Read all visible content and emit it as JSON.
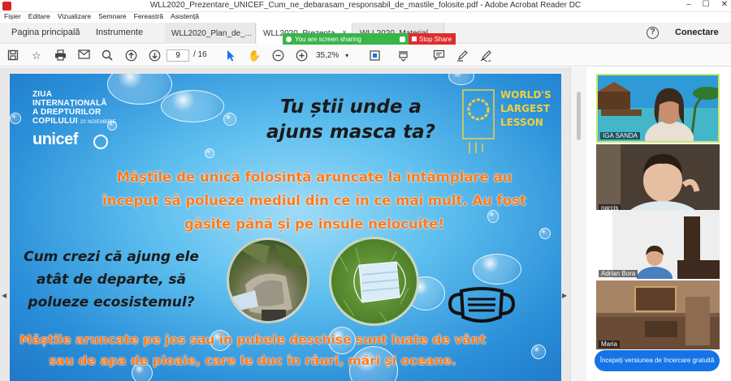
{
  "window": {
    "title": "WLL2020_Prezentare_UNICEF_Cum_ne_debarasam_responsabil_de_mastile_folosite.pdf - Adobe Acrobat Reader DC",
    "minimize": "–",
    "maximize": "☐",
    "close": "✕"
  },
  "menu": [
    "Fișier",
    "Editare",
    "Vizualizare",
    "Semnare",
    "Fereastră",
    "Asistență"
  ],
  "tabs": {
    "home": "Pagina principală",
    "tools": "Instrumente",
    "docs": [
      {
        "label": "WLL2020_Plan_de_...",
        "active": false
      },
      {
        "label": "WLL2020_Prezenta...",
        "active": true
      },
      {
        "label": "WLL2020_Material...",
        "active": false
      }
    ],
    "close_glyph": "×",
    "help": "?",
    "connect": "Conectare"
  },
  "share_bar": {
    "sharing_text": "You are screen sharing",
    "stop_text": "Stop Share"
  },
  "toolbar": {
    "page_current": "9",
    "page_total": "/ 16",
    "zoom": "35,2%"
  },
  "slide": {
    "unicef_line1": "ZIUA",
    "unicef_line2": "INTERNAȚIONALĂ",
    "unicef_line3": "A DREPTURILOR",
    "unicef_line4": "COPILULUI",
    "unicef_date": "20 NOIEMBRIE",
    "unicef_logo": "unicef",
    "question_title": "Tu știi unde a ajuns masca ta?",
    "wll_line1": "WORLD'S",
    "wll_line2": "LARGEST",
    "wll_line3": "LESSON",
    "paragraph1": "Măștile de unică folosință aruncate la întâmplare au început să polueze mediul din ce în ce mai mult. Au fost găsite până și pe insule nelocuite!",
    "question2": "Cum crezi că ajung ele atât de departe, să polueze ecosistemul?",
    "paragraph2": "Măștile aruncate pe jos sau în pubele deschise sunt luate de vânt sau de apa de ploaie, care le duc în râuri, mări și oceane."
  },
  "participants": [
    {
      "name": "IGA SANDA",
      "speaking": true
    },
    {
      "name": "narcis",
      "speaking": false
    },
    {
      "name": "Adrian Bora",
      "speaking": false
    },
    {
      "name": "Maria",
      "speaking": false
    }
  ],
  "trial_button": "Începeți versiunea de încercare gratuită",
  "colors": {
    "accent": "#1473e6",
    "share_green": "#39b54a",
    "share_red": "#e02c2c",
    "slide_orange": "#ff7a1a"
  }
}
